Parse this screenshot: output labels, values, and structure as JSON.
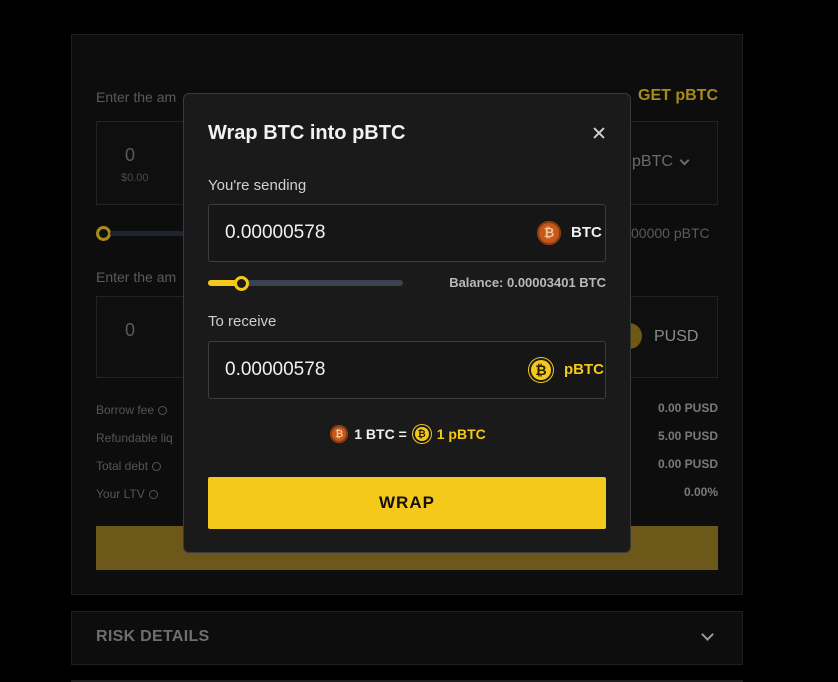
{
  "background": {
    "amount_label_1": "Enter the am",
    "get_pbtc_link": "GET pBTC",
    "collateral_value": "0",
    "collateral_usd": "$0.00",
    "collateral_token": "pBTC",
    "balance_partial": "00000 pBTC",
    "amount_label_2": "Enter the am",
    "borrow_value": "0",
    "borrow_token": "PUSD",
    "stats": [
      {
        "label": "Borrow fee",
        "value": "0.00 PUSD"
      },
      {
        "label": "Refundable liq",
        "value": "5.00 PUSD"
      },
      {
        "label": "Total debt",
        "value": "0.00 PUSD"
      },
      {
        "label": "Your LTV",
        "value": "0.00%"
      }
    ],
    "risk_title": "RISK DETAILS"
  },
  "modal": {
    "title": "Wrap BTC into pBTC",
    "sending_label": "You're sending",
    "sending_amount": "0.00000578",
    "sending_token": "BTC",
    "slider_fraction": 0.17,
    "balance_text": "Balance: 0.00003401 BTC",
    "receive_label": "To receive",
    "receive_amount": "0.00000578",
    "receive_token": "pBTC",
    "rate_left": "1 BTC =",
    "rate_right": "1 pBTC",
    "wrap_button": "WRAP"
  },
  "colors": {
    "accent": "#f5c91a",
    "btc": "#c4591a"
  }
}
